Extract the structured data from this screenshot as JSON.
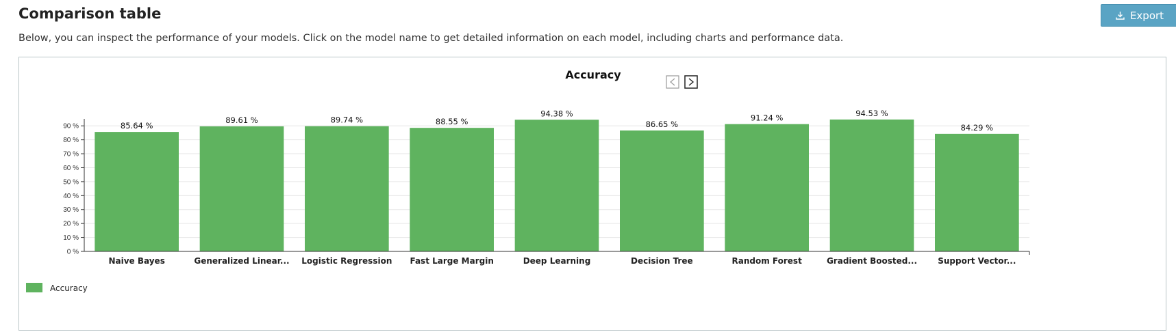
{
  "header": {
    "title": "Comparison table",
    "description": "Below, you can inspect the performance of your models. Click on the model name to get detailed information on each model, including charts and performance data.",
    "export_label": "Export"
  },
  "colors": {
    "accent": "#5aa4c4",
    "bar": "#5fb35f"
  },
  "icons": {
    "export": "download-icon",
    "prev": "chevron-left-icon",
    "next": "chevron-right-icon"
  },
  "chart_data": {
    "type": "bar",
    "title": "Accuracy",
    "categories": [
      "Naive Bayes",
      "Generalized Linear...",
      "Logistic Regression",
      "Fast Large Margin",
      "Deep Learning",
      "Decision Tree",
      "Random Forest",
      "Gradient Boosted...",
      "Support Vector..."
    ],
    "series": [
      {
        "name": "Accuracy",
        "values": [
          85.64,
          89.61,
          89.74,
          88.55,
          94.38,
          86.65,
          91.24,
          94.53,
          84.29
        ]
      }
    ],
    "data_labels": [
      "85.64 %",
      "89.61 %",
      "89.74 %",
      "88.55 %",
      "94.38 %",
      "86.65 %",
      "91.24 %",
      "94.53 %",
      "84.29 %"
    ],
    "yticks": [
      "0 %",
      "10 %",
      "20 %",
      "30 %",
      "40 %",
      "50 %",
      "60 %",
      "70 %",
      "80 %",
      "90 %"
    ],
    "ytick_values": [
      0,
      10,
      20,
      30,
      40,
      50,
      60,
      70,
      80,
      90
    ],
    "ylim": [
      0,
      95
    ],
    "grid": true,
    "legend_position": "bottom-left"
  }
}
